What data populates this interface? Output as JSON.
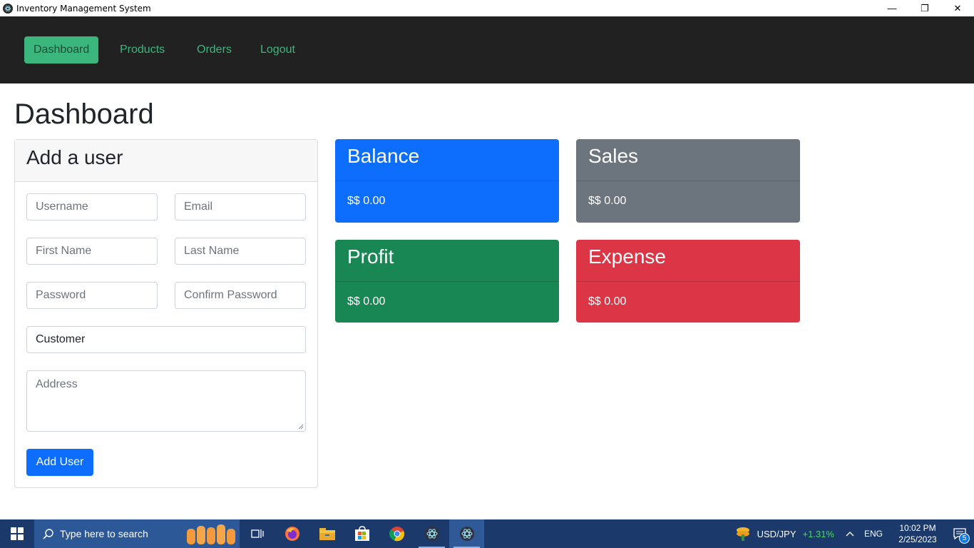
{
  "window": {
    "title": "Inventory Management System",
    "controls": {
      "minimize": "—",
      "restore": "❐",
      "close": "✕"
    }
  },
  "nav": {
    "items": [
      {
        "label": "Dashboard",
        "active": true
      },
      {
        "label": "Products",
        "active": false
      },
      {
        "label": "Orders",
        "active": false
      },
      {
        "label": "Logout",
        "active": false
      }
    ]
  },
  "page": {
    "title": "Dashboard"
  },
  "user_form": {
    "header": "Add a user",
    "username_placeholder": "Username",
    "email_placeholder": "Email",
    "first_name_placeholder": "First Name",
    "last_name_placeholder": "Last Name",
    "password_placeholder": "Password",
    "confirm_password_placeholder": "Confirm Password",
    "role_value": "Customer",
    "address_placeholder": "Address",
    "submit_label": "Add User"
  },
  "stats": [
    {
      "title": "Balance",
      "value": "$$ 0.00",
      "color": "#0d6efd"
    },
    {
      "title": "Sales",
      "value": "$$ 0.00",
      "color": "#6c757d"
    },
    {
      "title": "Profit",
      "value": "$$ 0.00",
      "color": "#198754"
    },
    {
      "title": "Expense",
      "value": "$$ 0.00",
      "color": "#dc3545"
    }
  ],
  "taskbar": {
    "search_placeholder": "Type here to search",
    "pinned": [
      "task-view-icon",
      "firefox-icon",
      "file-explorer-icon",
      "microsoft-store-icon",
      "chrome-icon",
      "electron-app-icon",
      "electron-app-icon"
    ],
    "tray": {
      "currency_pair": "USD/JPY",
      "currency_change": "+1.31%",
      "language": "ENG",
      "time": "10:02 PM",
      "date": "2/25/2023",
      "notification_count": "5"
    }
  }
}
